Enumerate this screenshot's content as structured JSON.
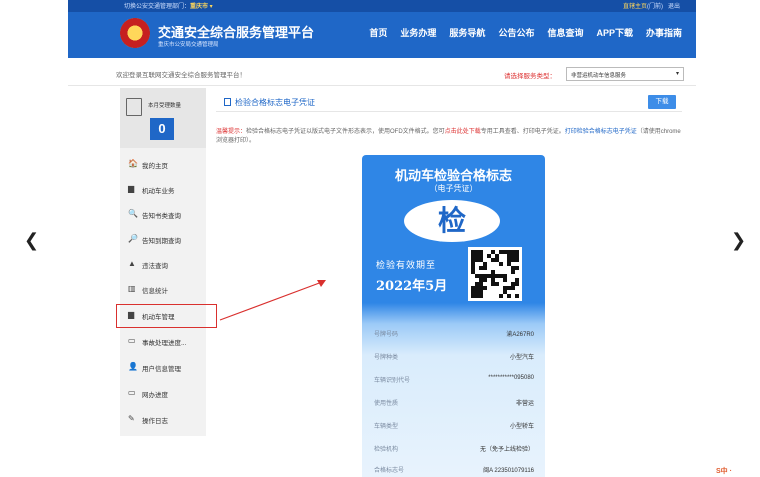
{
  "topbar": {
    "region_prefix": "切换公安交通管理部门：",
    "city": "重庆市 ▾",
    "home": "直辖主页",
    "home_suffix": "(门前)",
    "logout": "退出"
  },
  "header": {
    "title": "交通安全综合服务管理平台",
    "subtitle": "重庆市公安局交通管理局",
    "nav": [
      "首页",
      "业务办理",
      "服务导航",
      "公告公布",
      "信息查询",
      "APP下载",
      "办事指南"
    ]
  },
  "welcome": "欢迎登录互联网交通安全综合服务管理平台！",
  "service": {
    "label": "请选择服务类型：",
    "selected": "非营运机动车信息服务"
  },
  "sidebar": {
    "count_label": "本月受理数量",
    "count_value": "0",
    "items": [
      {
        "label": "我的主页",
        "icon": "home-icon",
        "glyph": "🏠"
      },
      {
        "label": "机动车业务",
        "icon": "car-icon",
        "glyph": "▆"
      },
      {
        "label": "告知书类查询",
        "icon": "search-icon",
        "glyph": "🔍"
      },
      {
        "label": "告知到期查询",
        "icon": "search-plus-icon",
        "glyph": "🔎"
      },
      {
        "label": "违法查询",
        "icon": "warning-icon",
        "glyph": "▲"
      },
      {
        "label": "信息统计",
        "icon": "chart-icon",
        "glyph": "▥"
      },
      {
        "label": "机动车管理",
        "icon": "car-icon",
        "glyph": "▆"
      },
      {
        "label": "事故处理进度...",
        "icon": "card-icon",
        "glyph": "▭"
      },
      {
        "label": "用户信息管理",
        "icon": "user-icon",
        "glyph": "👤"
      },
      {
        "label": "网办进度",
        "icon": "card-icon",
        "glyph": "▭"
      },
      {
        "label": "操作日志",
        "icon": "edit-icon",
        "glyph": "✎"
      }
    ]
  },
  "content": {
    "title": "检验合格标志电子凭证",
    "download": "下载",
    "tip_label": "温馨提示：",
    "tip_text1": "检验合格标志电子凭证以版式电子文件形态表示，使用OFD文件格式。您可",
    "tip_link": "点击此处下载",
    "tip_text2": "专用工具查看、打印电子凭证。",
    "tip_link2": "打印检验合格标志电子凭证",
    "tip_text3": "（请使用chrome浏览器打印）。"
  },
  "certificate": {
    "title": "机动车检验合格标志",
    "subtitle": "（电子凭证）",
    "badge": "检",
    "valid_label": "检验有效期至",
    "valid_date": "2022年5月",
    "fields": [
      {
        "key": "号牌号码",
        "value": "渝A267R0"
      },
      {
        "key": "号牌种类",
        "value": "小型汽车"
      },
      {
        "key": "车辆识别代号",
        "value": "***********095080"
      },
      {
        "key": "使用性质",
        "value": "非营运"
      },
      {
        "key": "车辆类型",
        "value": "小型轿车"
      },
      {
        "key": "检验机构",
        "value": "无（免予上线检验）"
      },
      {
        "key": "合格标志号",
        "value": "闽A 223501079116"
      }
    ]
  },
  "corner": "S中 ·",
  "colors": {
    "brand_blue": "#1f67c7",
    "cert_blue": "#2f86e6",
    "highlight_red": "#d9302e"
  }
}
